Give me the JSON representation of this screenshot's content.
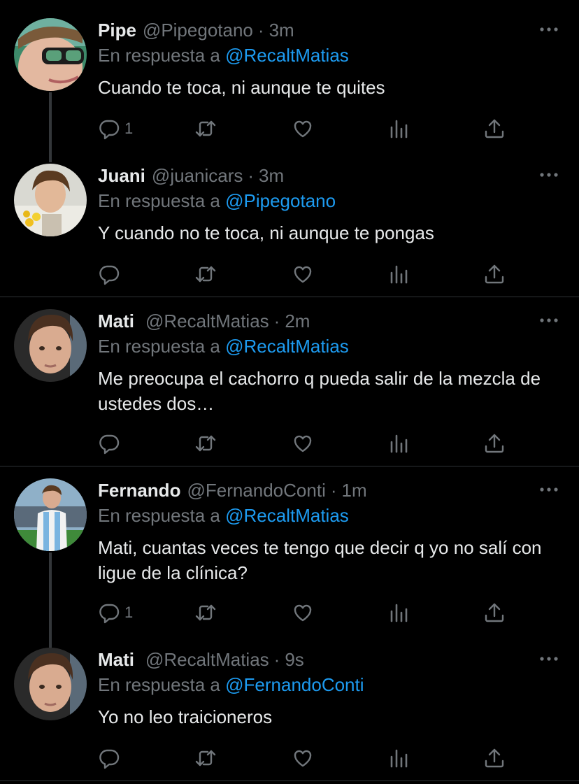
{
  "reply_prefix": "En respuesta a",
  "colors": {
    "background": "#000000",
    "text": "#e7e9ea",
    "secondary": "#71767b",
    "link": "#1d9bf0",
    "divider": "#2f3336"
  },
  "tweets": [
    {
      "name": "Pipe",
      "handle": "@Pipegotano",
      "time": "3m",
      "reply_to": "@RecaltMatias",
      "text": "Cuando te toca, ni aunque te quites",
      "reply_count": "1"
    },
    {
      "name": "Juani",
      "handle": "@juanicars",
      "time": "3m",
      "reply_to": "@Pipegotano",
      "text": "Y cuando no te toca, ni aunque te pongas",
      "reply_count": ""
    },
    {
      "name": "Mati",
      "handle": "@RecaltMatias",
      "time": "2m",
      "reply_to": "@RecaltMatias",
      "text": "Me preocupa el cachorro q pueda salir de la mezcla de ustedes dos…",
      "reply_count": ""
    },
    {
      "name": "Fernando",
      "handle": "@FernandoConti",
      "time": "1m",
      "reply_to": "@RecaltMatias",
      "text": "Mati, cuantas veces te tengo que decir q yo no salí con ligue de la clínica?",
      "reply_count": "1"
    },
    {
      "name": "Mati",
      "handle": "@RecaltMatias",
      "time": "9s",
      "reply_to": "@FernandoConti",
      "text": "Yo no leo traicioneros",
      "reply_count": ""
    }
  ],
  "icons": {
    "more": "more-icon",
    "reply": "reply-icon",
    "retweet": "retweet-icon",
    "like": "like-icon",
    "views": "views-icon",
    "share": "share-icon"
  }
}
